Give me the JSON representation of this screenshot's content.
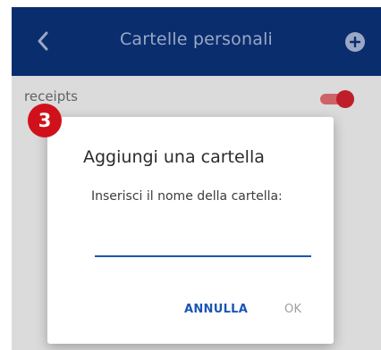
{
  "appbar": {
    "title": "Cartelle personali",
    "back_icon": "chevron-left-icon",
    "add_icon": "plus-circle-icon"
  },
  "list": {
    "items": [
      {
        "label": "receipts",
        "enabled": true
      }
    ]
  },
  "dialog": {
    "title": "Aggiungi una cartella",
    "message": "Inserisci il nome della cartella:",
    "input_value": "",
    "cancel_label": "ANNULLA",
    "ok_label": "OK"
  },
  "annotation": {
    "step_number": "3"
  },
  "colors": {
    "appbar": "#0a2d6e",
    "accent": "#1a56b4",
    "toggle": "#cc1f2e",
    "badge": "#d0111b"
  }
}
